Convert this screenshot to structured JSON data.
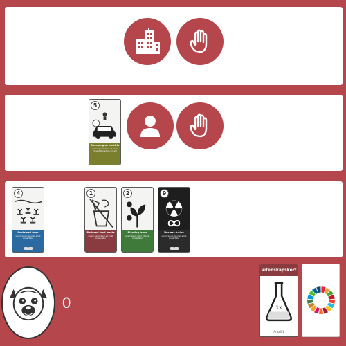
{
  "opponent_row": {
    "buttons": [
      {
        "icon": "city-buildings-icon"
      },
      {
        "icon": "raised-hand-icon"
      }
    ]
  },
  "player_row": {
    "played_card": {
      "number": "5",
      "title": "Overgang av elektrisk bil",
      "description": "Lorem ipsum dolor sit amet consectetur adipiscing elit",
      "color": "#7a7f2e",
      "icon": "car-icon"
    },
    "buttons": [
      {
        "icon": "person-icon"
      },
      {
        "icon": "raised-hand-icon"
      }
    ]
  },
  "hand": {
    "cards": [
      {
        "number": "4",
        "title": "Sustained farm",
        "description": "Lorem ipsum dolor sit amet consectetur",
        "tag": "x1",
        "color": "#2a6aa0",
        "icon": "crop-plants-icon"
      },
      {
        "number": "1",
        "title": "Reduced food waste",
        "description": "Lorem ipsum dolor sit amet consectetur",
        "tag": "",
        "color": "#8a3b3f",
        "icon": "no-food-waste-icon"
      },
      {
        "number": "2",
        "title": "Planting trees",
        "description": "Lorem ipsum dolor sit amet consectetur",
        "tag": "",
        "color": "#3f7a3a",
        "icon": "seedling-icon"
      },
      {
        "number": "9",
        "title": "Nuclear fusion",
        "description": "Lorem ipsum dolor sit amet consectetur",
        "tag": "x1",
        "color": "#2b2b2b",
        "icon": "radiation-icon"
      }
    ]
  },
  "player": {
    "avatar_icon": "pug-dog-icon",
    "score": "0"
  },
  "science_card": {
    "title": "Vitenskapskort",
    "label": "1x",
    "footer": "Antall 1",
    "icon": "flask-icon"
  },
  "sdg_card": {
    "icon": "sdg-wheel-icon",
    "colors": [
      "#e5243b",
      "#dda63a",
      "#4c9f38",
      "#c5192d",
      "#ff3a21",
      "#26bde2",
      "#fcc30b",
      "#a21942",
      "#fd6925",
      "#dd1367",
      "#fd9d24",
      "#bf8b2e",
      "#3f7e44",
      "#0a97d9",
      "#56c02b",
      "#00689d",
      "#19486a"
    ]
  },
  "colors": {
    "background": "#b5464b",
    "panel": "#ffffff"
  }
}
